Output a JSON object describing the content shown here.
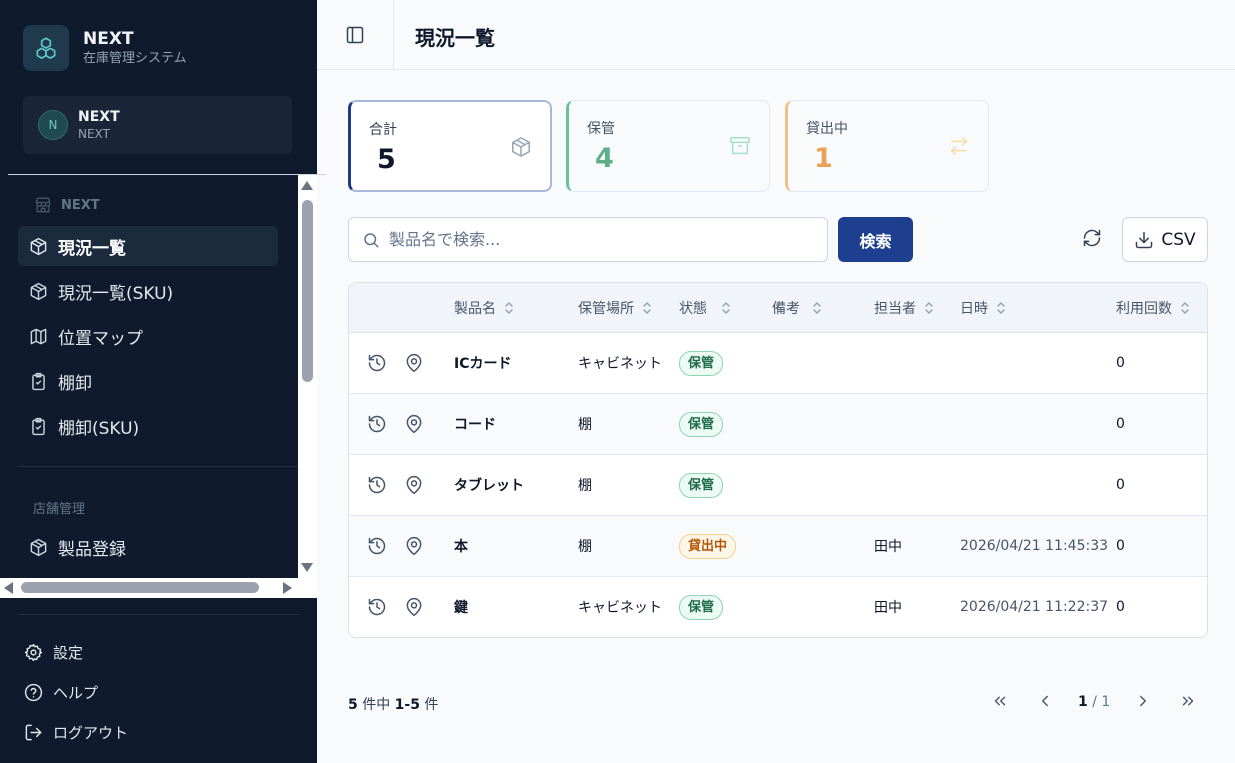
{
  "brand": {
    "name": "NEXT",
    "subtitle": "在庫管理システム"
  },
  "org": {
    "initial": "N",
    "name": "NEXT",
    "sub": "NEXT"
  },
  "nav": {
    "section_label": "NEXT",
    "items": [
      {
        "label": "現況一覧",
        "icon": "package-icon",
        "active": true
      },
      {
        "label": "現況一覧(SKU)",
        "icon": "package-icon"
      },
      {
        "label": "位置マップ",
        "icon": "map-icon"
      },
      {
        "label": "棚卸",
        "icon": "clipboard-check-icon"
      },
      {
        "label": "棚卸(SKU)",
        "icon": "clipboard-check-icon"
      }
    ],
    "store_section_label": "店舗管理",
    "store_items": [
      {
        "label": "製品登録",
        "icon": "package-icon"
      }
    ]
  },
  "footer_nav": {
    "settings": "設定",
    "help": "ヘルプ",
    "logout": "ログアウト"
  },
  "header": {
    "title": "現況一覧"
  },
  "stats": {
    "total": {
      "label": "合計",
      "value": "5"
    },
    "stored": {
      "label": "保管",
      "value": "4"
    },
    "lent": {
      "label": "貸出中",
      "value": "1"
    }
  },
  "search": {
    "placeholder": "製品名で検索...",
    "button": "検索"
  },
  "csv_label": "CSV",
  "table": {
    "columns": [
      "製品名",
      "保管場所",
      "状態",
      "備考",
      "担当者",
      "日時",
      "利用回数"
    ],
    "rows": [
      {
        "name": "ICカード",
        "location": "キャビネット",
        "status": "保管",
        "status_type": "stored",
        "note": "",
        "person": "",
        "datetime": "",
        "count": "0"
      },
      {
        "name": "コード",
        "location": "棚",
        "status": "保管",
        "status_type": "stored",
        "note": "",
        "person": "",
        "datetime": "",
        "count": "0"
      },
      {
        "name": "タブレット",
        "location": "棚",
        "status": "保管",
        "status_type": "stored",
        "note": "",
        "person": "",
        "datetime": "",
        "count": "0"
      },
      {
        "name": "本",
        "location": "棚",
        "status": "貸出中",
        "status_type": "lent",
        "note": "",
        "person": "田中",
        "datetime": "2026/04/21 11:45:33",
        "count": "0"
      },
      {
        "name": "鍵",
        "location": "キャビネット",
        "status": "保管",
        "status_type": "stored",
        "note": "",
        "person": "田中",
        "datetime": "2026/04/21 11:22:37",
        "count": "0"
      }
    ]
  },
  "pagination": {
    "total": "5",
    "total_suffix": " 件中 ",
    "range": "1-5",
    "range_suffix": " 件",
    "current": "1",
    "sep": " / ",
    "pages": "1"
  },
  "colors": {
    "sidebar": "#0f1b2d",
    "primary": "#1e3f8f",
    "stored": "#5fae8a",
    "lent": "#eaa257"
  }
}
